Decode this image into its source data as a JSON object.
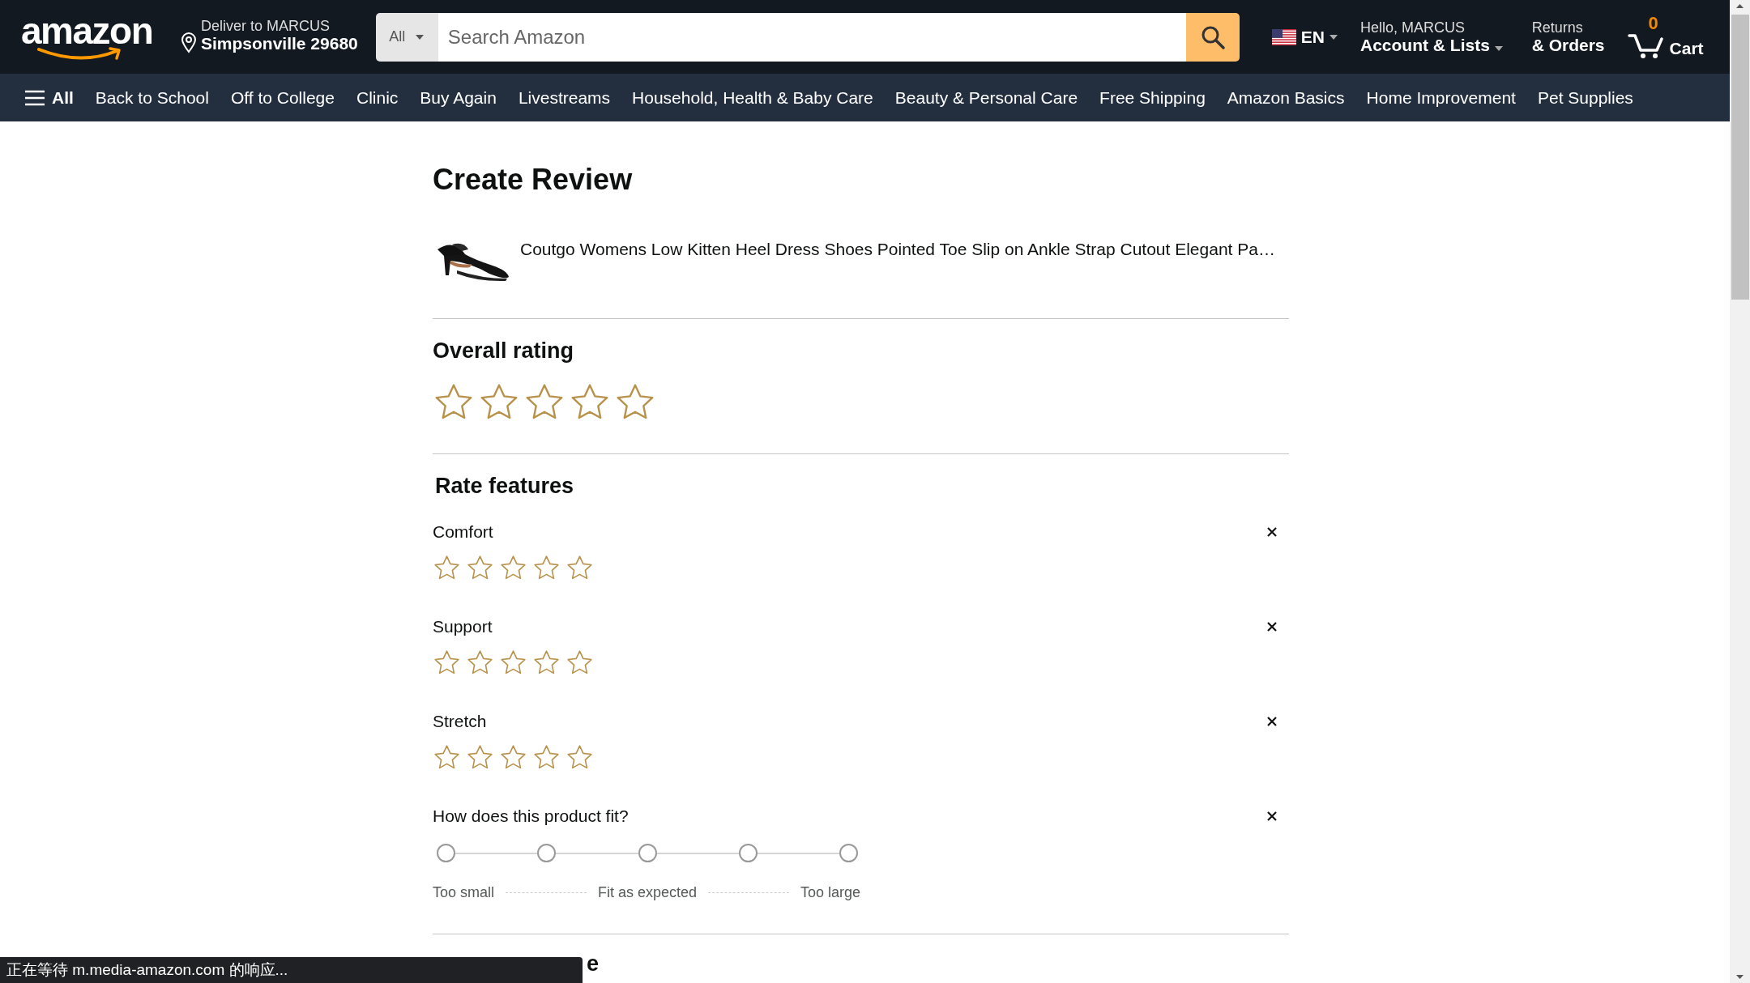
{
  "header": {
    "logo": "amazon",
    "deliver": {
      "line1": "Deliver to MARCUS",
      "line2": "Simpsonville 29680"
    },
    "search": {
      "category": "All",
      "placeholder": "Search Amazon"
    },
    "language": "EN",
    "account": {
      "greeting": "Hello, MARCUS",
      "label": "Account & Lists"
    },
    "returns": {
      "line1": "Returns",
      "line2": "& Orders"
    },
    "cart": {
      "count": "0",
      "label": "Cart"
    }
  },
  "nav": {
    "all_label": "All",
    "items": [
      "Back to School",
      "Off to College",
      "Clinic",
      "Buy Again",
      "Livestreams",
      "Household, Health & Baby Care",
      "Beauty & Personal Care",
      "Free Shipping",
      "Amazon Basics",
      "Home Improvement",
      "Pet Supplies"
    ]
  },
  "review": {
    "title": "Create Review",
    "product": {
      "name": "Coutgo Womens Low Kitten Heel Dress Shoes Pointed Toe Slip on Ankle Strap Cutout Elegant Pa…"
    },
    "overall": {
      "heading": "Overall rating",
      "stars": 0
    },
    "features": {
      "heading": "Rate features",
      "items": [
        {
          "label": "Comfort",
          "stars": 0
        },
        {
          "label": "Support",
          "stars": 0
        },
        {
          "label": "Stretch",
          "stars": 0
        }
      ]
    },
    "fit": {
      "question": "How does this product fit?",
      "options": [
        {
          "selected": false
        },
        {
          "selected": false
        },
        {
          "selected": false
        },
        {
          "selected": false
        },
        {
          "selected": false
        }
      ],
      "labels": [
        "Too small",
        "Fit as expected",
        "Too large"
      ]
    },
    "next_heading": "e"
  },
  "status_bar": "正在等待 m.media-amazon.com 的响应..."
}
